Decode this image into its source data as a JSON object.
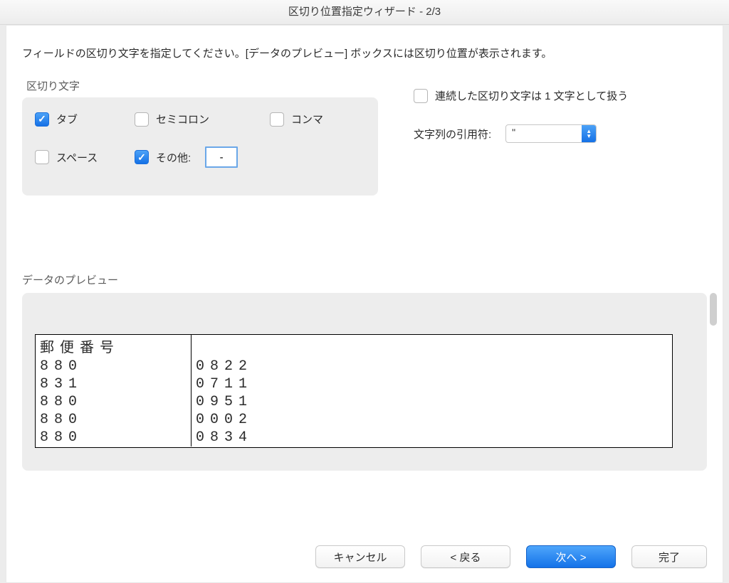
{
  "title": "区切り位置指定ウィザード - 2/3",
  "instruction": "フィールドの区切り文字を指定してください。[データのプレビュー] ボックスには区切り位置が表示されます。",
  "delimiters": {
    "group_title": "区切り文字",
    "tab": {
      "label": "タブ",
      "checked": true
    },
    "semicolon": {
      "label": "セミコロン",
      "checked": false
    },
    "comma": {
      "label": "コンマ",
      "checked": false
    },
    "space": {
      "label": "スペース",
      "checked": false
    },
    "other": {
      "label": "その他:",
      "checked": true,
      "value": "-"
    }
  },
  "consecutive": {
    "label": "連続した区切り文字は 1 文字として扱う",
    "checked": false
  },
  "text_qualifier": {
    "label": "文字列の引用符:",
    "value": "\""
  },
  "preview": {
    "title": "データのプレビュー",
    "rows": [
      {
        "a": "郵便番号",
        "b": ""
      },
      {
        "a": "880",
        "b": "0822"
      },
      {
        "a": "831",
        "b": "0711"
      },
      {
        "a": "880",
        "b": "0951"
      },
      {
        "a": "880",
        "b": "0002"
      },
      {
        "a": "880",
        "b": "0834"
      }
    ]
  },
  "buttons": {
    "cancel": "キャンセル",
    "back": "< 戻る",
    "next": "次へ >",
    "finish": "完了"
  }
}
